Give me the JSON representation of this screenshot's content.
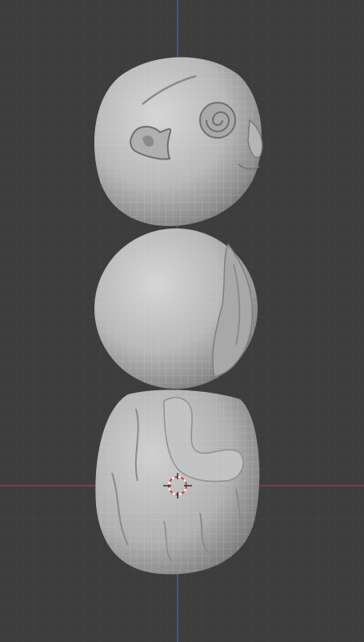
{
  "viewport": {
    "background": "#3d3d3d",
    "grid_minor_color": "#444444",
    "grid_major_color": "#4a4a4a",
    "x_axis_color": "#9a3f47",
    "y_axis_color": "#4a6aa8",
    "cursor_colors": [
      "#d33a3a",
      "#ffffff"
    ]
  },
  "object": {
    "semantic": "sculpted-snowman",
    "parts": [
      "head-sphere",
      "body-sphere",
      "base-sphere"
    ],
    "surface_color": "#bcbcbc",
    "wireframe_overlay": true
  }
}
